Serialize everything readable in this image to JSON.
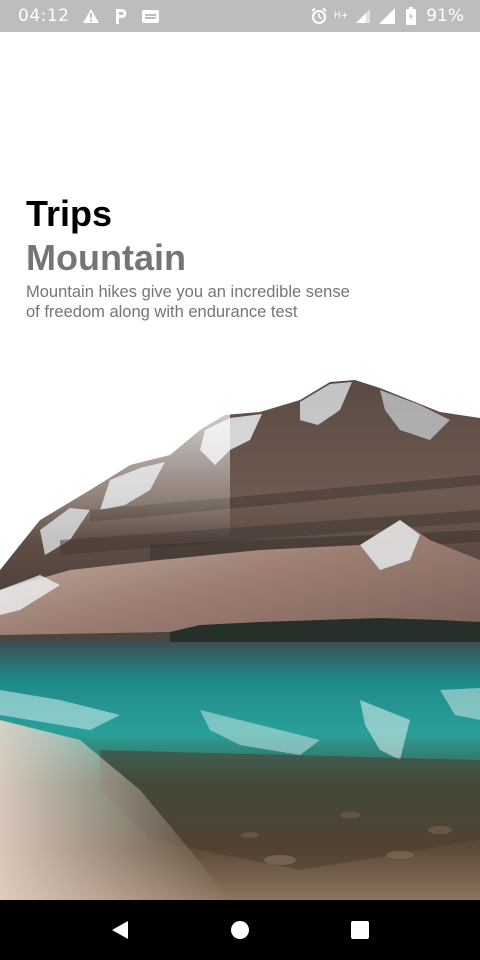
{
  "status_bar": {
    "time": "04:12",
    "network_label": "H+",
    "battery_percent": "91%",
    "left_icons": [
      "warning-icon",
      "parking-icon",
      "message-icon"
    ],
    "right_icons": [
      "alarm-icon",
      "signal-icon",
      "signal-full-icon",
      "battery-icon"
    ]
  },
  "content": {
    "title": "Trips",
    "subtitle": "Mountain",
    "description": "Mountain hikes give you an incredible sense of freedom along with endurance test"
  },
  "nav_bar": {
    "buttons": [
      "back-icon",
      "home-icon",
      "recents-icon"
    ]
  },
  "colors": {
    "status_bar_bg": "#bdbdbd",
    "title": "#000000",
    "subtitle": "#757575",
    "nav_bar_bg": "#000000"
  }
}
